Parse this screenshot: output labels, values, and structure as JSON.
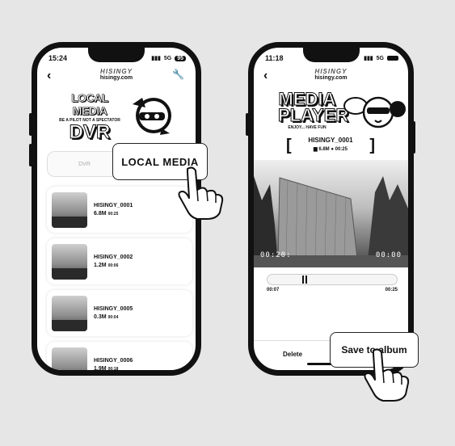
{
  "left_phone": {
    "status": {
      "time": "15:24",
      "network": "5G",
      "battery": "95"
    },
    "brand": {
      "line1": "HISINGY",
      "line2": "hisingy.com"
    },
    "logo": {
      "line1": "LOCAL MEDIA",
      "tagline": "BE A PILOT NOT A SPECTATOR",
      "line2": "DVR"
    },
    "tabs": [
      {
        "label": "DVR"
      },
      {
        "label": ""
      }
    ],
    "files": [
      {
        "name": "HISINGY_0001",
        "size": "6.8M",
        "duration": "00:25"
      },
      {
        "name": "HISINGY_0002",
        "size": "1.2M",
        "duration": "00:06"
      },
      {
        "name": "HISINGY_0005",
        "size": "0.3M",
        "duration": "00:04"
      },
      {
        "name": "HISINGY_0006",
        "size": "1.9M",
        "duration": "00:18"
      }
    ]
  },
  "callouts": {
    "local_media": "LOCAL MEDIA",
    "save_to_album": "Save to album"
  },
  "right_phone": {
    "status": {
      "time": "11:18",
      "network": "5G"
    },
    "brand": {
      "line1": "HISINGY",
      "line2": "hisingy.com"
    },
    "logo": {
      "line1": "MEDIA",
      "line2": "PLAYER",
      "tagline": "ENJOY... HAVE FUN"
    },
    "file": {
      "name": "HISINGY_0001",
      "size": "6.8M",
      "duration": "00:25"
    },
    "player": {
      "current": "00:07",
      "total": "00:25",
      "progress": 0.28
    },
    "actions": {
      "delete": "Delete"
    }
  }
}
